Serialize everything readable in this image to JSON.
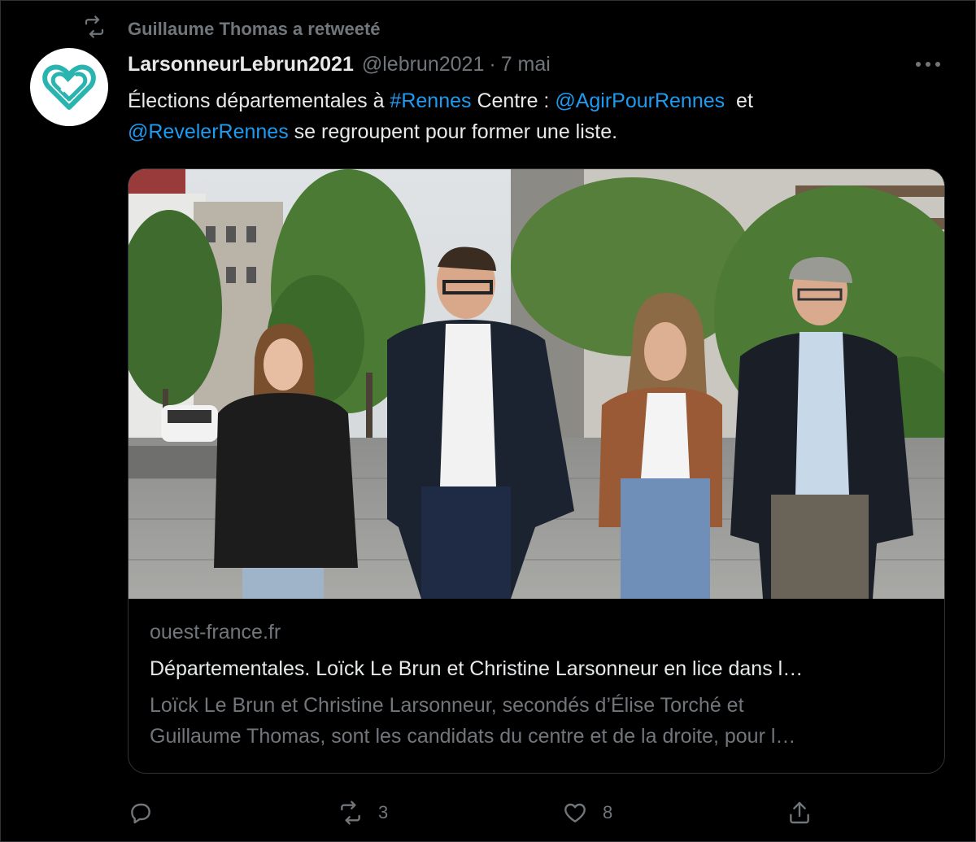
{
  "retweet": {
    "label": "Guillaume Thomas a retweeté",
    "icon": "retweet-icon"
  },
  "author": {
    "name": "LarsonneurLebrun2021",
    "handle": "@lebrun2021",
    "separator": "·",
    "date": "7 mai",
    "avatar_icon": "heart-logo-icon",
    "avatar_color": "#2ab4b0"
  },
  "tweet": {
    "text_1": "Élections départementales à ",
    "hashtag": "#Rennes",
    "text_2": " Centre : ",
    "mention_1": "@AgirPourRennes",
    "text_3": "  et",
    "mention_2": "@RevelerRennes",
    "text_4": " se regroupent pour former une liste."
  },
  "card": {
    "domain": "ouest-france.fr",
    "title": "Départementales. Loïck Le Brun et Christine Larsonneur en lice dans l…",
    "description_line1": "Loïck Le Brun et Christine Larsonneur, secondés d’Élise Torché et",
    "description_line2": "Guillaume Thomas, sont les candidats du centre et de la droite, pour l…"
  },
  "actions": {
    "reply_icon": "reply-icon",
    "retweet_icon": "retweet-icon",
    "retweet_count": "3",
    "like_icon": "heart-icon",
    "like_count": "8",
    "share_icon": "share-icon"
  },
  "colors": {
    "background": "#000000",
    "text": "#e7e9ea",
    "muted": "#71767b",
    "link": "#1d9bf0",
    "border": "#2f3336"
  }
}
